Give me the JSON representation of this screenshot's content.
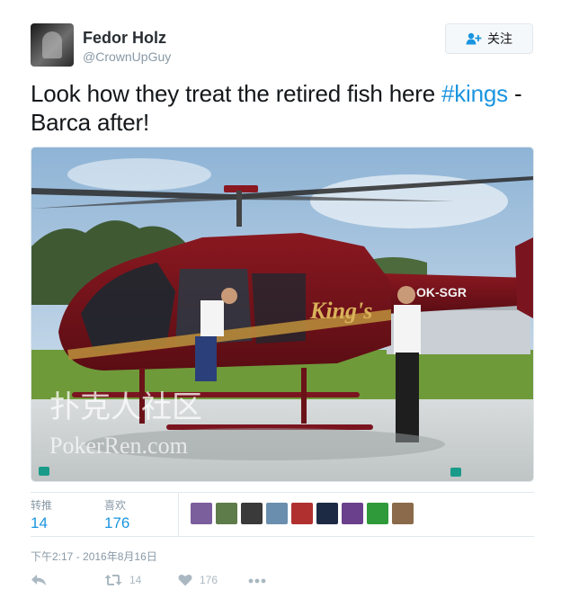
{
  "author": {
    "name": "Fedor Holz",
    "handle": "@CrownUpGuy"
  },
  "follow_button": {
    "label": "关注",
    "icon": "add-user-icon"
  },
  "tweet": {
    "text_before": "Look how they treat the retired fish here ",
    "hashtag": "#kings",
    "text_after": " - Barca after!"
  },
  "photo": {
    "subject": "helicopter",
    "painted_text": "King's",
    "registration": "OK-SGR",
    "watermark_cn": "扑克人社区",
    "watermark_en": "PokerRen.com"
  },
  "stats": {
    "retweets_label": "转推",
    "retweets_value": "14",
    "likes_label": "喜欢",
    "likes_value": "176",
    "liker_avatar_colors": [
      "#7b5e9c",
      "#5e7b4a",
      "#3a3a3a",
      "#6a8fae",
      "#b03030",
      "#1d2a44",
      "#6a3f8c",
      "#2f9a3a",
      "#8a6a4a"
    ]
  },
  "timestamp": "下午2:17 - 2016年8月16日",
  "actions": {
    "reply_icon": "reply-icon",
    "retweet_icon": "retweet-icon",
    "retweet_count": "14",
    "like_icon": "heart-icon",
    "like_count": "176",
    "more_icon": "more-icon"
  }
}
